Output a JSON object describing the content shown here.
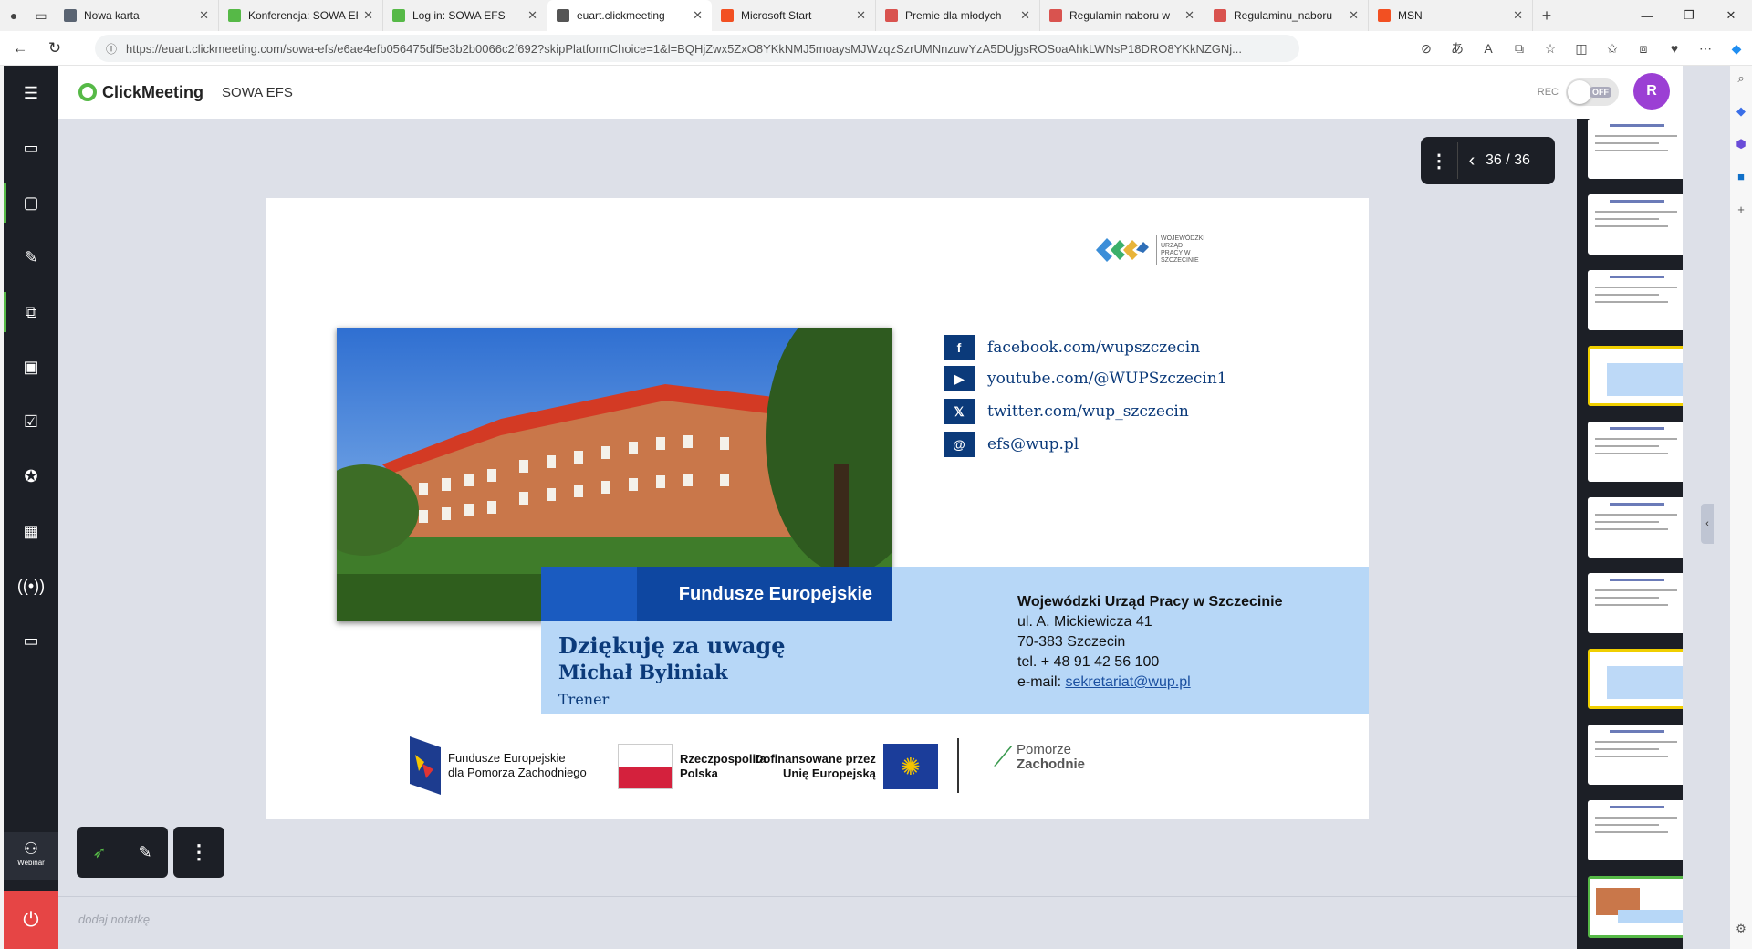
{
  "browser": {
    "tabs": [
      {
        "title": "Nowa karta",
        "active": false,
        "fav_color": "#5a6472"
      },
      {
        "title": "Konferencja: SOWA EFS",
        "active": false,
        "fav_color": "#56b947"
      },
      {
        "title": "Log in: SOWA EFS",
        "active": false,
        "fav_color": "#56b947"
      },
      {
        "title": "euart.clickmeeting",
        "active": true,
        "fav_color": "#555"
      },
      {
        "title": "Microsoft Start",
        "active": false,
        "fav_color": "#f25022"
      },
      {
        "title": "Premie dla młodych",
        "active": false,
        "fav_color": "#d9534f"
      },
      {
        "title": "Regulamin naboru w",
        "active": false,
        "fav_color": "#d9534f"
      },
      {
        "title": "Regulaminu_naboru",
        "active": false,
        "fav_color": "#d9534f"
      },
      {
        "title": "MSN",
        "active": false,
        "fav_color": "#f25022"
      }
    ],
    "url": "https://euart.clickmeeting.com/sowa-efs/e6ae4efb056475df5e3b2b0066c2f692?skipPlatformChoice=1&l=BQHjZwx5ZxO8YKkNMJ5moaysMJWzqzSzrUMNnzuwYzA5DUjgsROSoaAhkLWNsP18DRO8YKkNZGNj..."
  },
  "app": {
    "brand": "ClickMeeting",
    "room": "SOWA EFS",
    "rec_label": "REC",
    "rec_state": "OFF",
    "avatar_initial": "R",
    "page_counter": "36 / 36",
    "webinar_label": "Webinar",
    "notes_placeholder": "dodaj notatkę"
  },
  "slide": {
    "social": [
      {
        "icon": "f",
        "text": "facebook.com/wupszczecin"
      },
      {
        "icon": "▶",
        "text": "youtube.com/@WUPSzczecin1"
      },
      {
        "icon": "𝕏",
        "text": "twitter.com/wup_szczecin"
      },
      {
        "icon": "@",
        "text": "efs@wup.pl"
      }
    ],
    "wup_logo": "WOJEWÓDZKI URZĄD PRACY W SZCZECINIE",
    "fe_banner": "Fundusze Europejskie",
    "thanks": "Dziękuję za uwagę",
    "speaker": "Michał Byliniak",
    "role": "Trener",
    "org_name": "Wojewódzki Urząd Pracy w Szczecinie",
    "org_street": "ul. A. Mickiewicza 41",
    "org_city": "70-383 Szczecin",
    "org_tel": "tel. + 48 91 42 56 100",
    "org_email_label": "e-mail:",
    "org_email": "sekretariat@wup.pl",
    "footer": {
      "fe_line1": "Fundusze Europejskie",
      "fe_line2": "dla Pomorza Zachodniego",
      "rp_line1": "Rzeczpospolita",
      "rp_line2": "Polska",
      "eu_line1": "Dofinansowane przez",
      "eu_line2": "Unię Europejską",
      "pz_line1": "Pomorze",
      "pz_line2": "Zachodnie"
    }
  },
  "thumbnails": {
    "count": 11,
    "selected_index": 10,
    "yellow_indexes": [
      3,
      7
    ]
  }
}
